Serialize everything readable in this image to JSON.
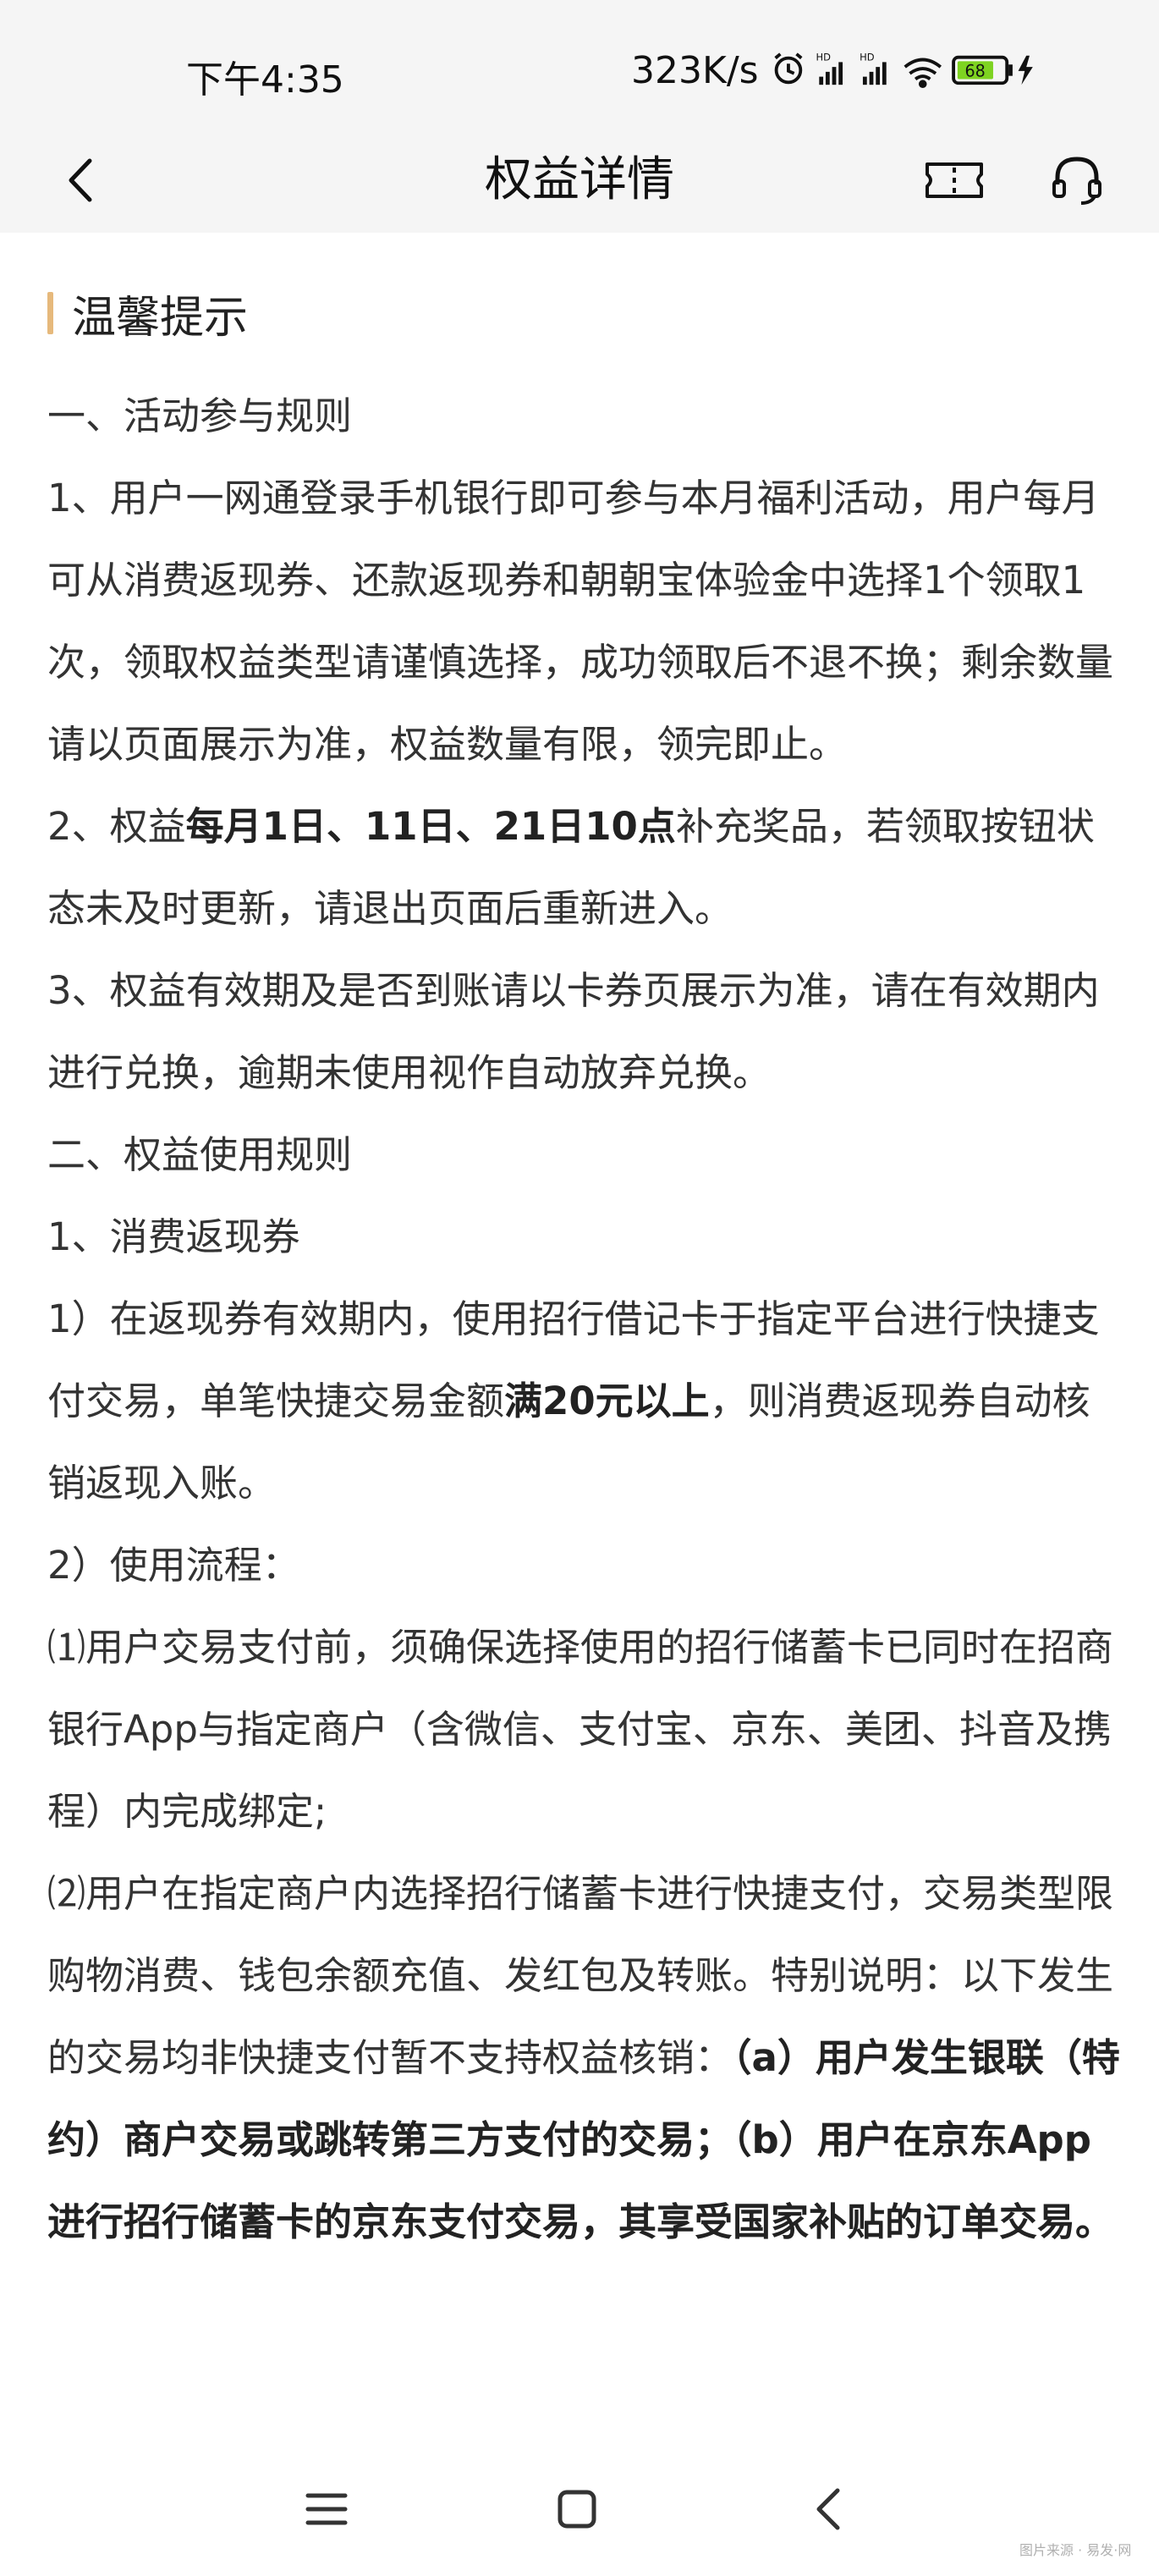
{
  "status_bar": {
    "time": "下午4:35",
    "network_speed": "323K/s",
    "battery": "68",
    "icons": [
      "alarm-icon",
      "hd-signal-icon",
      "hd-signal-icon",
      "wifi-icon",
      "battery-icon",
      "charging-icon"
    ]
  },
  "nav": {
    "title": "权益详情",
    "back_icon": "chevron-left-icon",
    "ticket_icon": "ticket-icon",
    "support_icon": "headset-icon"
  },
  "tip": {
    "heading": "温馨提示",
    "lines": {
      "l1": "一、活动参与规则",
      "l2": "1、用户一网通登录手机银行即可参与本月福利活动，用户每月可从消费返现券、还款返现券和朝朝宝体验金中选择1个领取1次，领取权益类型请谨慎选择，成功领取后不退不换；剩余数量请以页面展示为准，权益数量有限，领完即止。",
      "l3a": "2、权益",
      "l3b": "每月1日、11日、21日10点",
      "l3c": "补充奖品，若领取按钮状态未及时更新，请退出页面后重新进入。",
      "l4": "3、权益有效期及是否到账请以卡券页展示为准，请在有效期内进行兑换，逾期未使用视作自动放弃兑换。",
      "l5": "二、权益使用规则",
      "l6": "1、消费返现券",
      "l7a": "1）在返现券有效期内，使用招行借记卡于指定平台进行快捷支付交易，单笔快捷交易金额",
      "l7b": "满20元以上",
      "l7c": "，则消费返现券自动核销返现入账。",
      "l8": "2）使用流程：",
      "l9": "⑴用户交易支付前，须确保选择使用的招行储蓄卡已同时在招商银行App与指定商户（含微信、支付宝、京东、美团、抖音及携程）内完成绑定;",
      "l10a": "⑵用户在指定商户内选择招行储蓄卡进行快捷支付，交易类型限购物消费、钱包余额充值、发红包及转账。特别说明：以下发生的交易均非快捷支付暂不支持权益核销：",
      "l10b": "（a）用户发生银联（特约）商户交易或跳转第三方支付的交易；（b）用户在京东App进行招行储蓄卡的京东支付交易，其享受国家补贴的订单交易。"
    }
  },
  "system_nav": {
    "menu_icon": "menu-icon",
    "home_icon": "square-home-icon",
    "back_icon": "triangle-back-icon"
  },
  "watermark": "图片来源 · 易发·网"
}
